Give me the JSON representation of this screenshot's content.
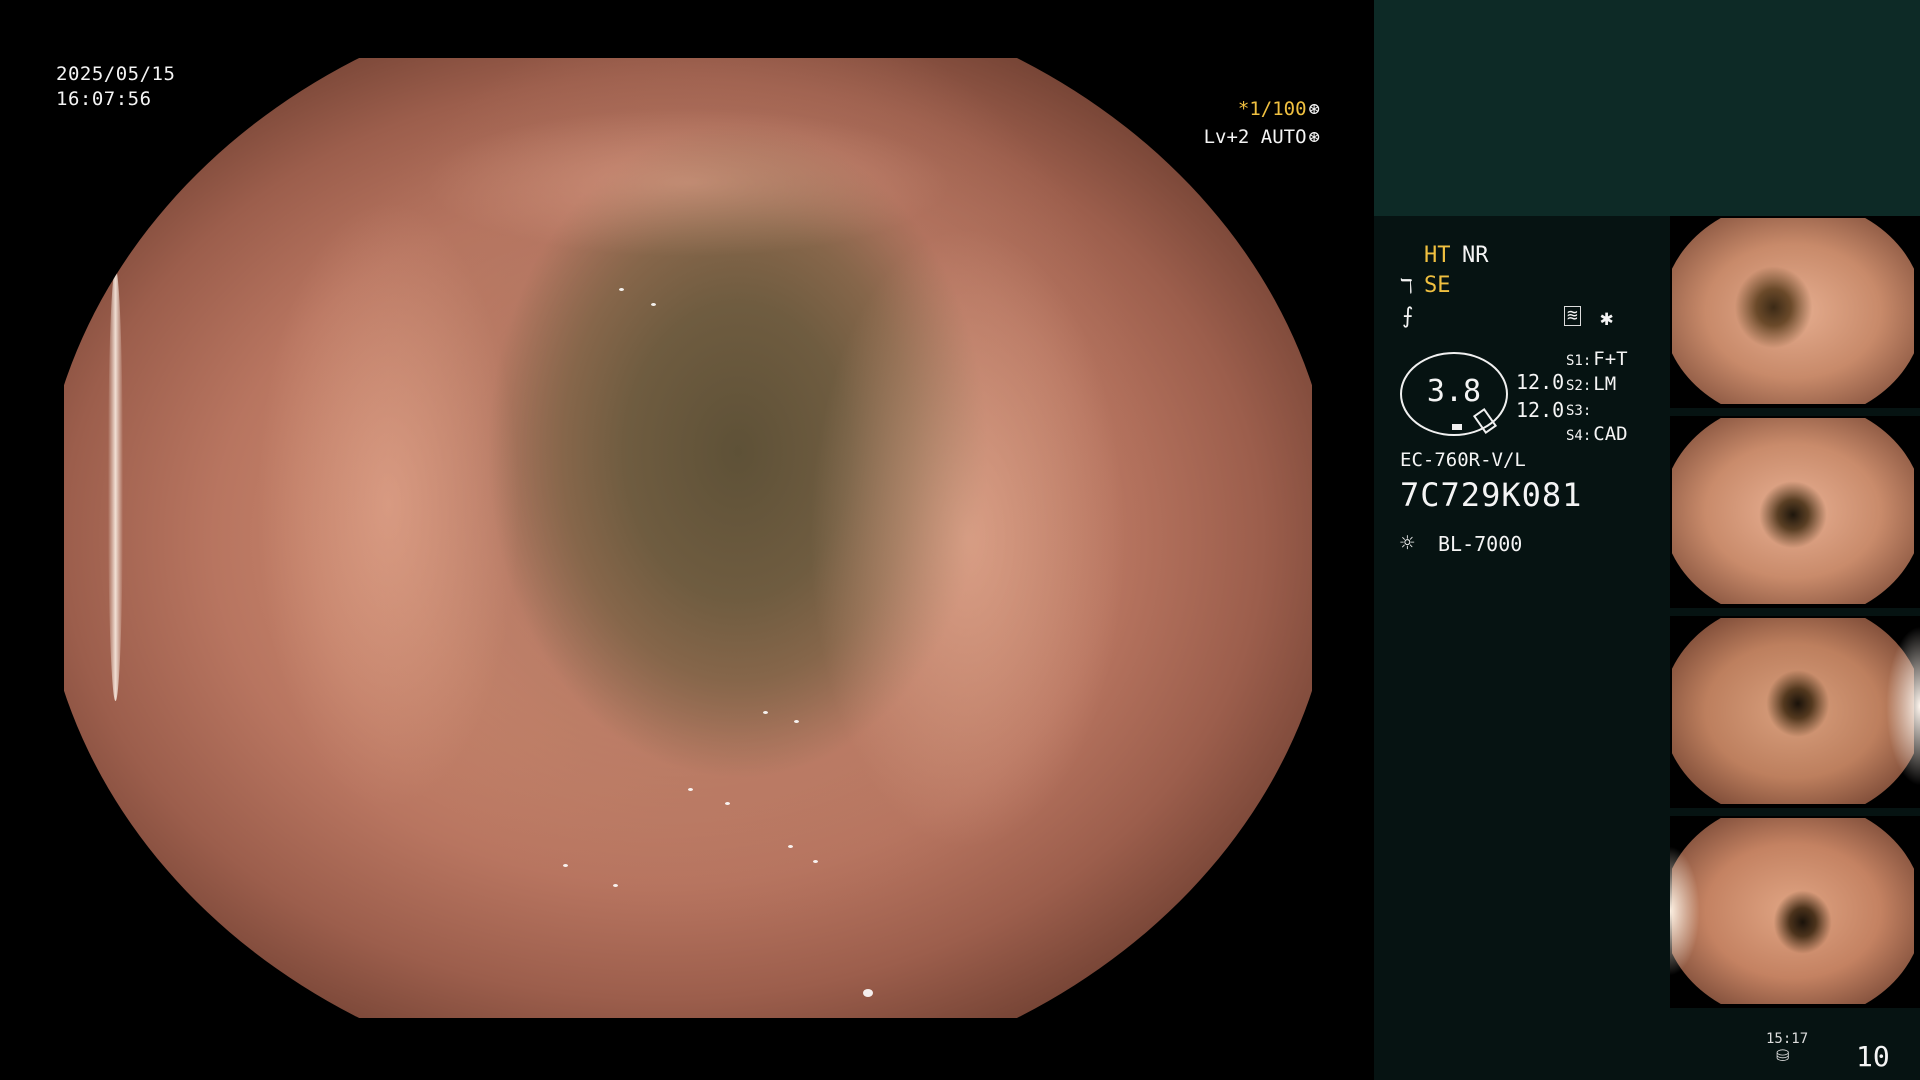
{
  "overlay": {
    "date": "2025/05/15",
    "time": "16:07:56",
    "shutter": "*1/100",
    "shutter_icon": "⊛",
    "level": "Lv+2 AUTO",
    "level_icon": "⊛"
  },
  "panel": {
    "ht": "HT",
    "nr": "NR",
    "se_icon": "ℸ",
    "se": "SE",
    "f_icon": "⨍",
    "wave_icon": "≋",
    "star_icon": "✱",
    "gauge_value": "3.8",
    "value1": "12.0",
    "value2": "12.0",
    "slots": [
      {
        "key": "S1:",
        "value": "F+T"
      },
      {
        "key": "S2:",
        "value": "LM"
      },
      {
        "key": "S3:",
        "value": ""
      },
      {
        "key": "S4:",
        "value": "CAD"
      }
    ],
    "scope_model": "EC-760R-V/L",
    "serial": "7C729K081",
    "light_icon": "☼",
    "light_source": "BL-7000"
  },
  "footer": {
    "storage_time": "15:17",
    "storage_icon": "⛁",
    "count": "10"
  },
  "colors": {
    "accent_yellow": "#f0c040",
    "panel_top": "#0d2a26",
    "panel_bottom": "#061312"
  }
}
